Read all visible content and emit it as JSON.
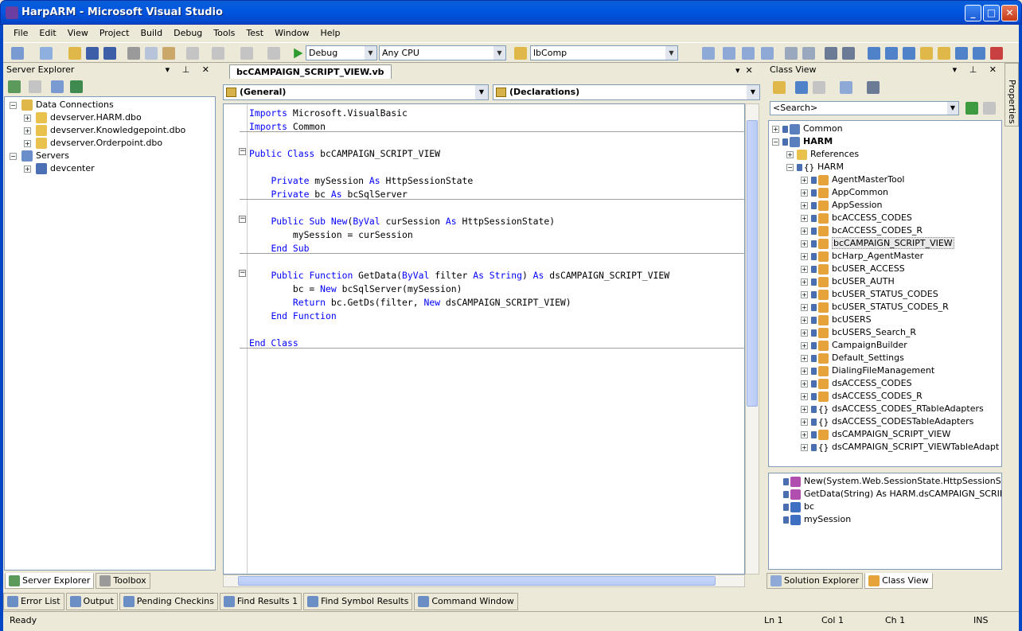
{
  "window": {
    "title": "HarpARM - Microsoft Visual Studio"
  },
  "menu": [
    "File",
    "Edit",
    "View",
    "Project",
    "Build",
    "Debug",
    "Tools",
    "Test",
    "Window",
    "Help"
  ],
  "toolbar": {
    "config": "Debug",
    "platform": "Any CPU",
    "find_combo": "lbComp"
  },
  "server_explorer": {
    "title": "Server Explorer",
    "data_connections": "Data Connections",
    "connections": [
      "devserver.HARM.dbo",
      "devserver.Knowledgepoint.dbo",
      "devserver.Orderpoint.dbo"
    ],
    "servers": "Servers",
    "server_items": [
      "devcenter"
    ],
    "tabs": [
      "Server Explorer",
      "Toolbox"
    ]
  },
  "editor": {
    "doc_tab": "bcCAMPAIGN_SCRIPT_VIEW.vb",
    "left_combo": "(General)",
    "right_combo": "(Declarations)"
  },
  "code": [
    {
      "parts": [
        {
          "k": true,
          "t": "Imports"
        },
        {
          "k": false,
          "t": " Microsoft.VisualBasic"
        }
      ]
    },
    {
      "parts": [
        {
          "k": true,
          "t": "Imports"
        },
        {
          "k": false,
          "t": " Common"
        }
      ]
    },
    {
      "parts": []
    },
    {
      "parts": [
        {
          "k": true,
          "t": "Public Class"
        },
        {
          "k": false,
          "t": " bcCAMPAIGN_SCRIPT_VIEW"
        }
      ]
    },
    {
      "parts": []
    },
    {
      "parts": [
        {
          "k": false,
          "t": "    "
        },
        {
          "k": true,
          "t": "Private"
        },
        {
          "k": false,
          "t": " mySession "
        },
        {
          "k": true,
          "t": "As"
        },
        {
          "k": false,
          "t": " HttpSessionState"
        }
      ]
    },
    {
      "parts": [
        {
          "k": false,
          "t": "    "
        },
        {
          "k": true,
          "t": "Private"
        },
        {
          "k": false,
          "t": " bc "
        },
        {
          "k": true,
          "t": "As"
        },
        {
          "k": false,
          "t": " bcSqlServer"
        }
      ]
    },
    {
      "parts": []
    },
    {
      "parts": [
        {
          "k": false,
          "t": "    "
        },
        {
          "k": true,
          "t": "Public Sub New"
        },
        {
          "k": false,
          "t": "("
        },
        {
          "k": true,
          "t": "ByVal"
        },
        {
          "k": false,
          "t": " curSession "
        },
        {
          "k": true,
          "t": "As"
        },
        {
          "k": false,
          "t": " HttpSessionState)"
        }
      ]
    },
    {
      "parts": [
        {
          "k": false,
          "t": "        mySession = curSession"
        }
      ]
    },
    {
      "parts": [
        {
          "k": false,
          "t": "    "
        },
        {
          "k": true,
          "t": "End Sub"
        }
      ]
    },
    {
      "parts": []
    },
    {
      "parts": [
        {
          "k": false,
          "t": "    "
        },
        {
          "k": true,
          "t": "Public Function"
        },
        {
          "k": false,
          "t": " GetData("
        },
        {
          "k": true,
          "t": "ByVal"
        },
        {
          "k": false,
          "t": " filter "
        },
        {
          "k": true,
          "t": "As String"
        },
        {
          "k": false,
          "t": ") "
        },
        {
          "k": true,
          "t": "As"
        },
        {
          "k": false,
          "t": " dsCAMPAIGN_SCRIPT_VIEW"
        }
      ]
    },
    {
      "parts": [
        {
          "k": false,
          "t": "        bc = "
        },
        {
          "k": true,
          "t": "New"
        },
        {
          "k": false,
          "t": " bcSqlServer(mySession)"
        }
      ]
    },
    {
      "parts": [
        {
          "k": false,
          "t": "        "
        },
        {
          "k": true,
          "t": "Return"
        },
        {
          "k": false,
          "t": " bc.GetDs(filter, "
        },
        {
          "k": true,
          "t": "New"
        },
        {
          "k": false,
          "t": " dsCAMPAIGN_SCRIPT_VIEW)"
        }
      ]
    },
    {
      "parts": [
        {
          "k": false,
          "t": "    "
        },
        {
          "k": true,
          "t": "End Function"
        }
      ]
    },
    {
      "parts": []
    },
    {
      "parts": [
        {
          "k": true,
          "t": "End Class"
        }
      ]
    }
  ],
  "class_view": {
    "title": "Class View",
    "search_placeholder": "<Search>",
    "root_common": "Common",
    "root_harm": "HARM",
    "references": "References",
    "namespace": "HARM",
    "types": [
      {
        "name": "AgentMasterTool",
        "icon": "class"
      },
      {
        "name": "AppCommon",
        "icon": "class"
      },
      {
        "name": "AppSession",
        "icon": "class"
      },
      {
        "name": "bcACCESS_CODES",
        "icon": "class"
      },
      {
        "name": "bcACCESS_CODES_R",
        "icon": "class"
      },
      {
        "name": "bcCAMPAIGN_SCRIPT_VIEW",
        "icon": "class",
        "selected": true
      },
      {
        "name": "bcHarp_AgentMaster",
        "icon": "class"
      },
      {
        "name": "bcUSER_ACCESS",
        "icon": "class"
      },
      {
        "name": "bcUSER_AUTH",
        "icon": "class"
      },
      {
        "name": "bcUSER_STATUS_CODES",
        "icon": "class"
      },
      {
        "name": "bcUSER_STATUS_CODES_R",
        "icon": "class"
      },
      {
        "name": "bcUSERS",
        "icon": "class"
      },
      {
        "name": "bcUSERS_Search_R",
        "icon": "class"
      },
      {
        "name": "CampaignBuilder",
        "icon": "class"
      },
      {
        "name": "Default_Settings",
        "icon": "class"
      },
      {
        "name": "DialingFileManagement",
        "icon": "class"
      },
      {
        "name": "dsACCESS_CODES",
        "icon": "class"
      },
      {
        "name": "dsACCESS_CODES_R",
        "icon": "class"
      },
      {
        "name": "dsACCESS_CODES_RTableAdapters",
        "icon": "namespace"
      },
      {
        "name": "dsACCESS_CODESTableAdapters",
        "icon": "namespace"
      },
      {
        "name": "dsCAMPAIGN_SCRIPT_VIEW",
        "icon": "class"
      },
      {
        "name": "dsCAMPAIGN_SCRIPT_VIEWTableAdapt",
        "icon": "namespace"
      }
    ],
    "members": [
      "New(System.Web.SessionState.HttpSessionState)",
      "GetData(String) As HARM.dsCAMPAIGN_SCRIPT_V",
      "bc",
      "mySession"
    ],
    "tabs": [
      "Solution Explorer",
      "Class View"
    ]
  },
  "properties_tab": "Properties",
  "dock_tabs": [
    "Error List",
    "Output",
    "Pending Checkins",
    "Find Results 1",
    "Find Symbol Results",
    "Command Window"
  ],
  "status": {
    "text": "Ready",
    "ln": "Ln 1",
    "col": "Col 1",
    "ch": "Ch 1",
    "mode": "INS"
  }
}
